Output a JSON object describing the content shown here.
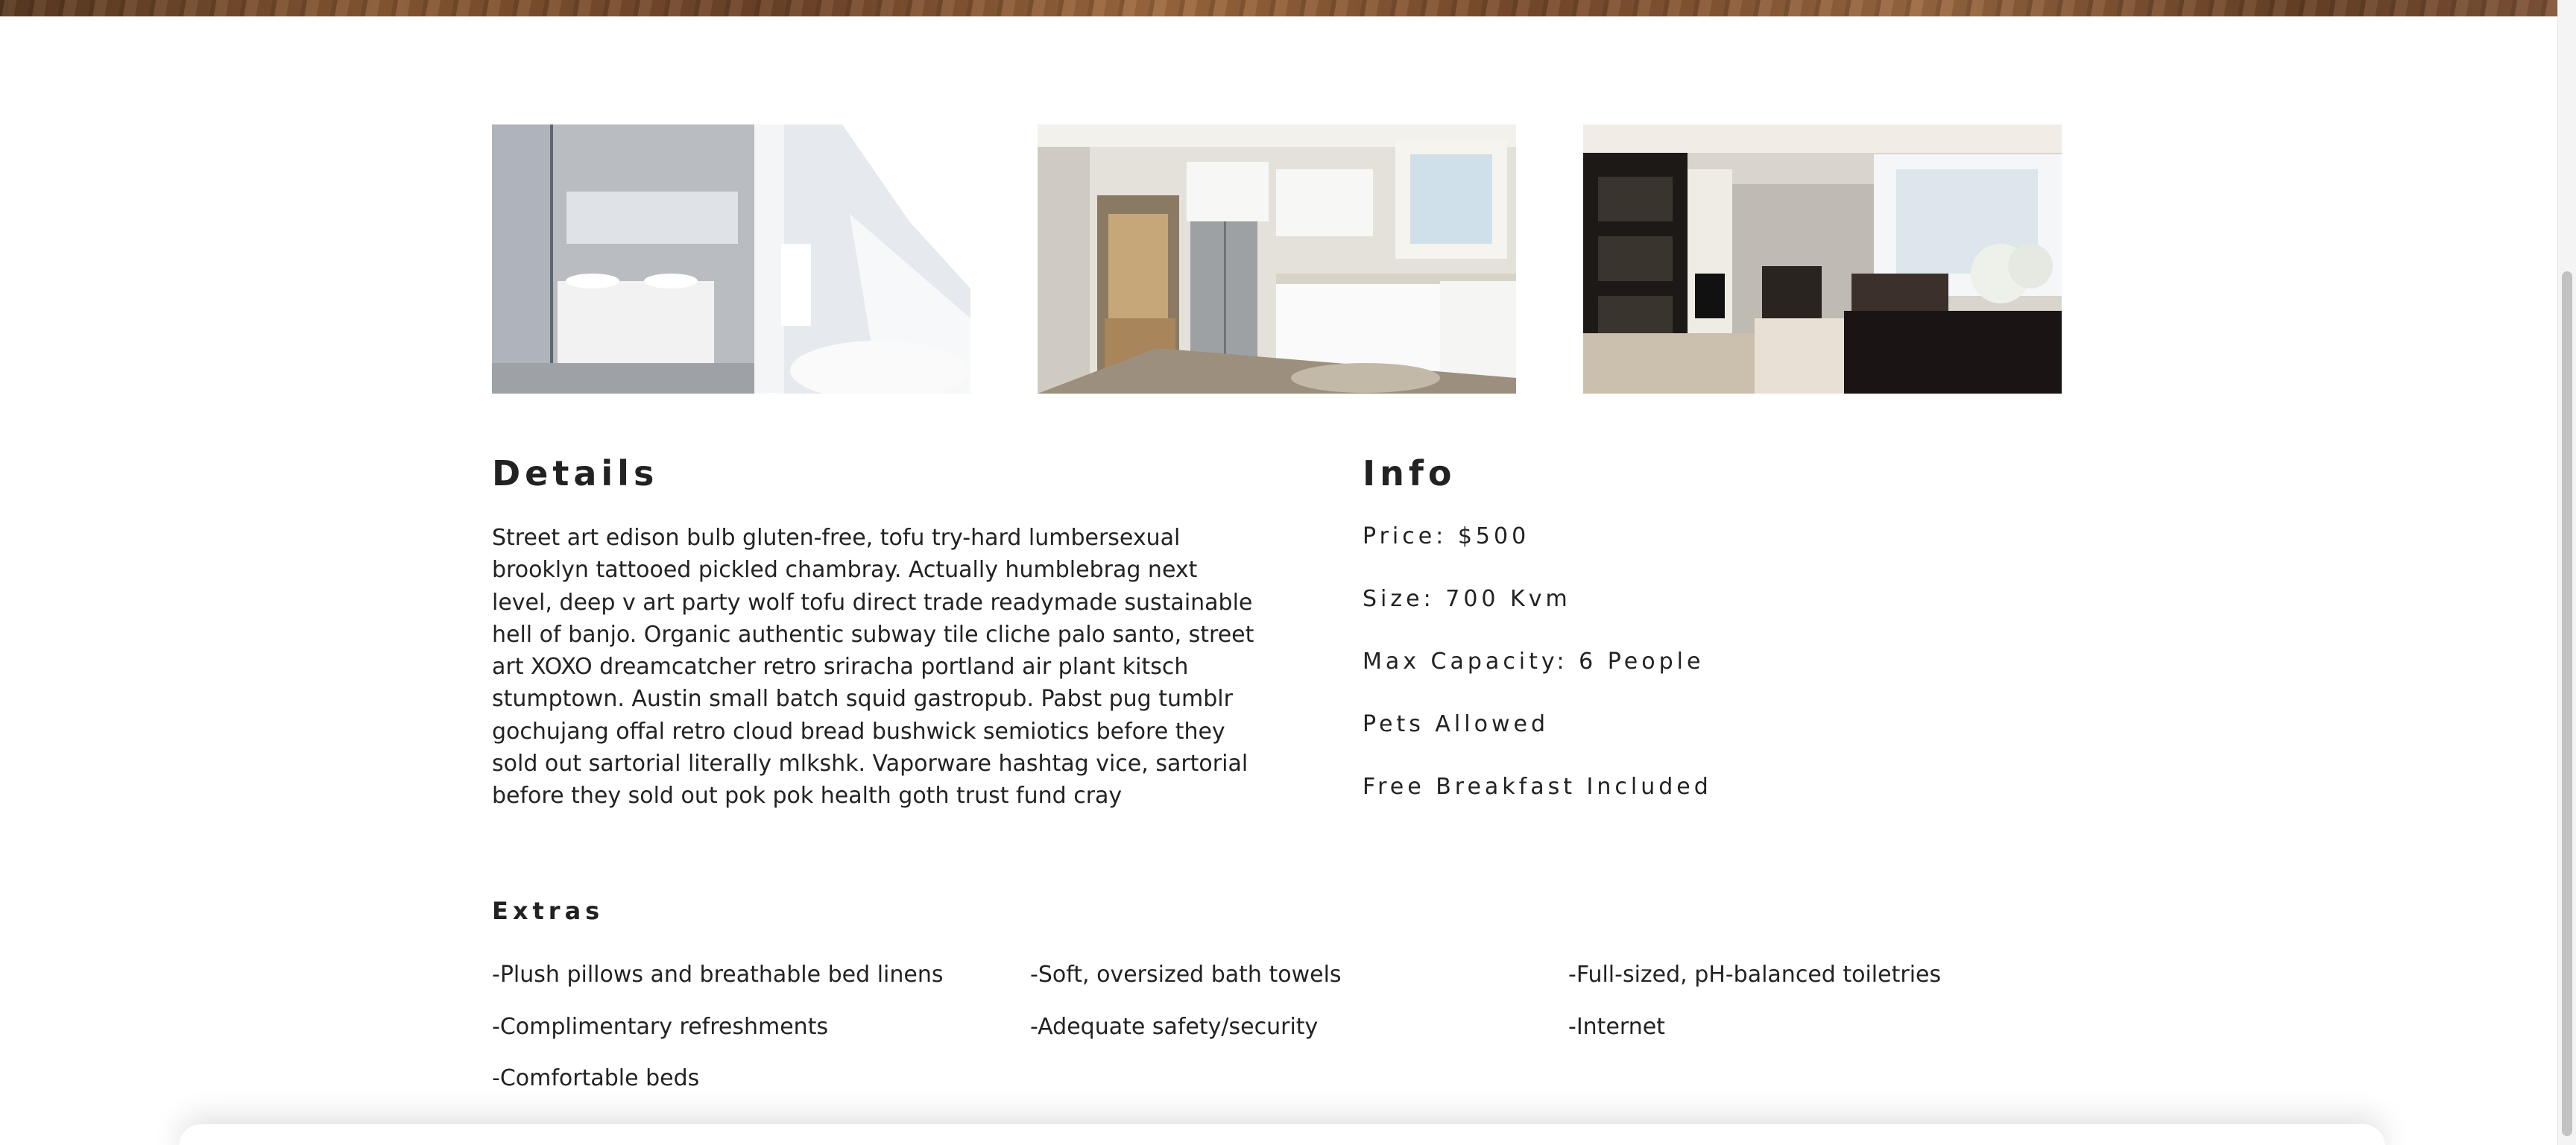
{
  "gallery": {
    "photos": [
      {
        "alt": "bathroom-photo"
      },
      {
        "alt": "kitchen-photo"
      },
      {
        "alt": "living-room-photo"
      }
    ]
  },
  "details": {
    "heading": "Details",
    "text": "Street art edison bulb gluten-free, tofu try-hard lumbersexual brooklyn tattooed pickled chambray. Actually humblebrag next level, deep v art party wolf tofu direct trade readymade sustainable hell of banjo. Organic authentic subway tile cliche palo santo, street art XOXO dreamcatcher retro sriracha portland air plant kitsch stumptown. Austin small batch squid gastropub. Pabst pug tumblr gochujang offal retro cloud bread bushwick semiotics before they sold out sartorial literally mlkshk. Vaporware hashtag vice, sartorial before they sold out pok pok health goth trust fund cray"
  },
  "info": {
    "heading": "Info",
    "items": [
      "Price: $500",
      "Size: 700 Kvm",
      "Max Capacity: 6 People",
      "Pets Allowed",
      "Free Breakfast Included"
    ]
  },
  "extras": {
    "heading": "Extras",
    "items": [
      "-Plush pillows and breathable bed linens",
      "-Soft, oversized bath towels",
      "-Full-sized, pH-balanced toiletries",
      "-Complimentary refreshments",
      "-Adequate safety/security",
      "-Internet",
      "-Comfortable beds"
    ]
  }
}
